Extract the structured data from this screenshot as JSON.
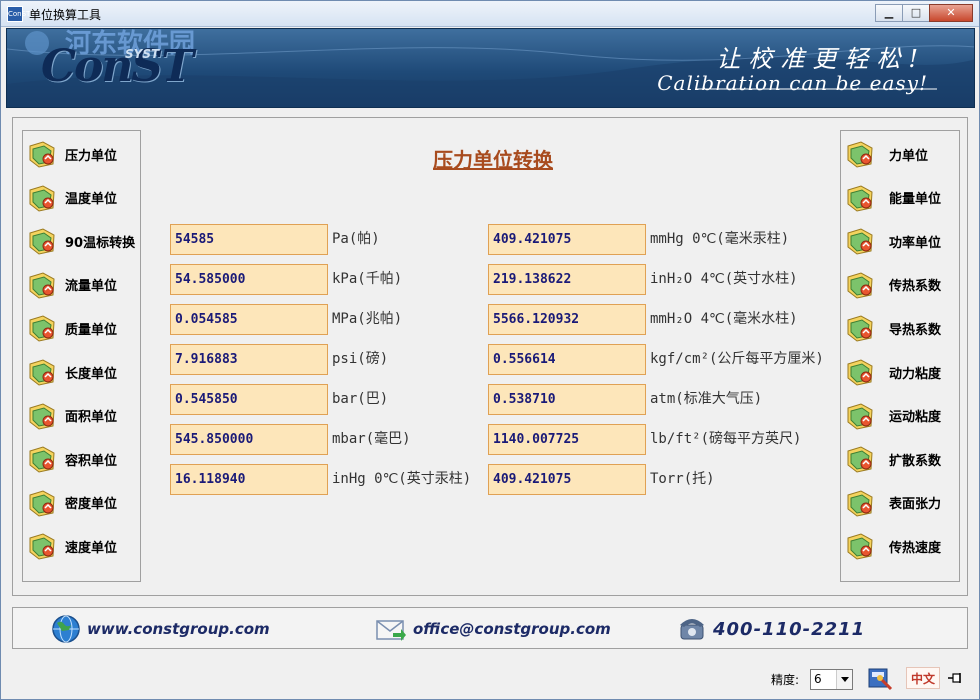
{
  "window": {
    "title": "单位换算工具",
    "app_icon_text": "ConST"
  },
  "banner": {
    "logo": "ConST",
    "logo_sub": "SYST",
    "watermark": "河东软件园",
    "slogan_cn": "让校准更轻松!",
    "slogan_en": "Calibration can be easy!"
  },
  "left_nav": [
    {
      "label": "压力单位",
      "icon": "gauge-icon"
    },
    {
      "label": "温度单位",
      "icon": "thermometer-icon"
    },
    {
      "label": "90温标转换",
      "icon": "scale-icon"
    },
    {
      "label": "流量单位",
      "icon": "flow-icon"
    },
    {
      "label": "质量单位",
      "icon": "weight-icon"
    },
    {
      "label": "长度单位",
      "icon": "ruler-icon"
    },
    {
      "label": "面积单位",
      "icon": "area-icon"
    },
    {
      "label": "容积单位",
      "icon": "volume-icon"
    },
    {
      "label": "密度单位",
      "icon": "density-icon"
    },
    {
      "label": "速度单位",
      "icon": "speed-icon"
    }
  ],
  "right_nav": [
    {
      "label": "力单位",
      "icon": "force-icon"
    },
    {
      "label": "能量单位",
      "icon": "energy-icon"
    },
    {
      "label": "功率单位",
      "icon": "power-icon"
    },
    {
      "label": "传热系数",
      "icon": "heat-transfer-icon"
    },
    {
      "label": "导热系数",
      "icon": "conductivity-icon"
    },
    {
      "label": "动力粘度",
      "icon": "dynamic-viscosity-icon"
    },
    {
      "label": "运动粘度",
      "icon": "kinematic-viscosity-icon"
    },
    {
      "label": "扩散系数",
      "icon": "diffusion-icon"
    },
    {
      "label": "表面张力",
      "icon": "surface-tension-icon"
    },
    {
      "label": "传热速度",
      "icon": "heat-rate-icon"
    }
  ],
  "page_title": "压力单位转换",
  "left_fields": [
    {
      "value": "54585",
      "unit": "Pa(帕)"
    },
    {
      "value": "54.585000",
      "unit": "kPa(千帕)"
    },
    {
      "value": "0.054585",
      "unit": "MPa(兆帕)"
    },
    {
      "value": "7.916883",
      "unit": "psi(磅)"
    },
    {
      "value": "0.545850",
      "unit": "bar(巴)"
    },
    {
      "value": "545.850000",
      "unit": "mbar(毫巴)"
    },
    {
      "value": "16.118940",
      "unit": "inHg 0℃(英寸汞柱)"
    }
  ],
  "right_fields": [
    {
      "value": "409.421075",
      "unit": "mmHg 0℃(毫米汞柱)"
    },
    {
      "value": "219.138622",
      "unit": "inH₂O 4℃(英寸水柱)"
    },
    {
      "value": "5566.120932",
      "unit": "mmH₂O 4℃(毫米水柱)"
    },
    {
      "value": "0.556614",
      "unit": "kgf/cm²(公斤每平方厘米)"
    },
    {
      "value": "0.538710",
      "unit": "atm(标准大气压)"
    },
    {
      "value": "1140.007725",
      "unit": "lb/ft²(磅每平方英尺)"
    },
    {
      "value": "409.421075",
      "unit": "Torr(托)"
    }
  ],
  "contact": {
    "website": "www.constgroup.com",
    "email": "office@constgroup.com",
    "phone": "400-110-2211"
  },
  "footer": {
    "precision_label": "精度:",
    "precision_value": "6",
    "language_label": "中文"
  },
  "colors": {
    "field_bg": "#fde6ba",
    "field_border": "#e0a154",
    "title_color": "#a84b1e",
    "banner_dark": "#163a63"
  }
}
